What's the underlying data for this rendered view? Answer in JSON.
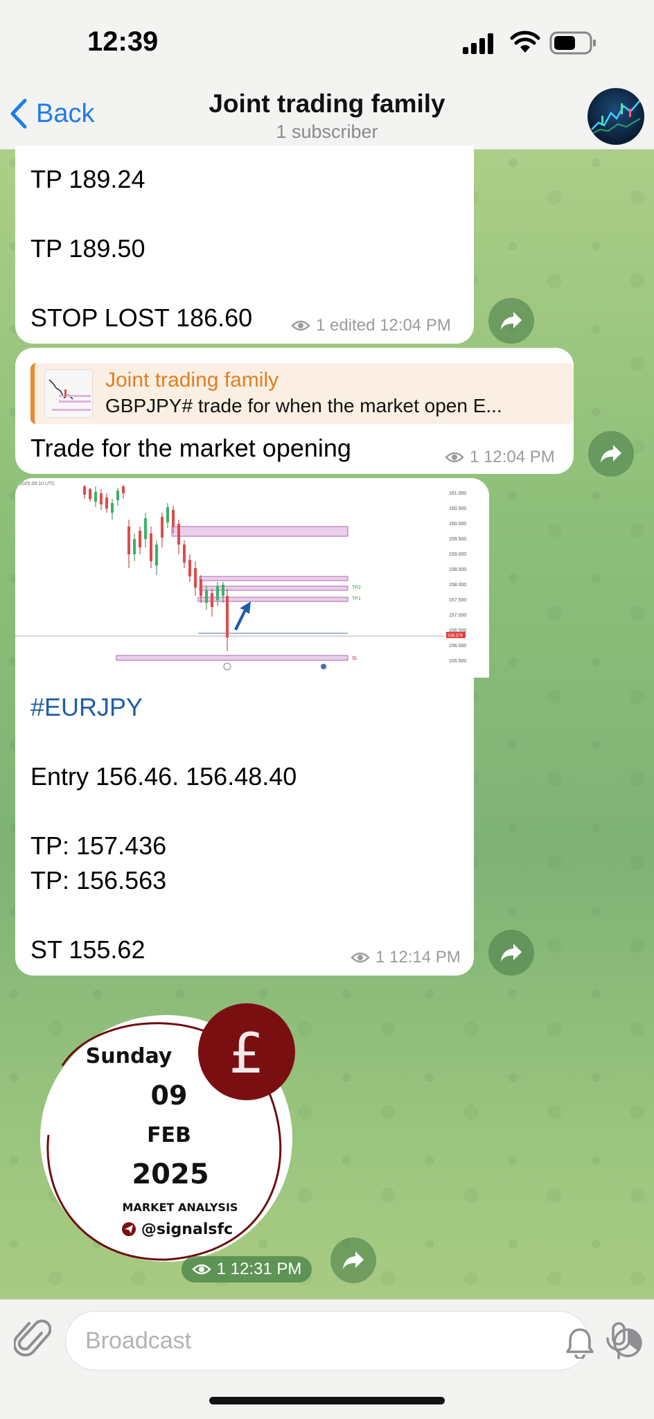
{
  "status_bar": {
    "time": "12:39"
  },
  "header": {
    "back_label": "Back",
    "title": "Joint trading family",
    "subtitle": "1 subscriber"
  },
  "messages": [
    {
      "lines": [
        "TP 189.24",
        "TP 189.50",
        "STOP LOST 186.60"
      ],
      "views": "1",
      "edited": "edited",
      "time": "12:04 PM"
    },
    {
      "reply_name": "Joint trading family",
      "reply_text": "GBPJPY# trade for when the market open E...",
      "text": "Trade for the market opening",
      "views": "1",
      "time": "12:04 PM"
    },
    {
      "hashtag": "#EURJPY",
      "lines": [
        "Entry 156.46.  156.48.40",
        "TP:   157.436",
        "TP:    156.563",
        "ST 155.62"
      ],
      "views": "1",
      "time": "12:14 PM",
      "chart_labels": {
        "tp1": "TP1",
        "tp2": "TP2",
        "sl": "SL",
        "header": "2025 09:10 UTC",
        "prices": [
          "161.000",
          "160.500",
          "160.000",
          "159.500",
          "159.000",
          "158.500",
          "158.000",
          "157.500",
          "157.000",
          "156.500",
          "156.000",
          "155.500"
        ],
        "current_price": "156.379"
      }
    },
    {
      "sticker": {
        "day": "Sunday",
        "date": "09",
        "month": "FEB",
        "year": "2025",
        "caption": "MARKET ANALYSIS",
        "handle": "@signalsfc",
        "currency_symbol": "£"
      },
      "views": "1",
      "time": "12:31 PM"
    }
  ],
  "input": {
    "placeholder": "Broadcast"
  },
  "colors": {
    "accent": "#1f7ce6",
    "reply_accent": "#e07e22",
    "hashtag": "#1f5da8",
    "sticker_maroon": "#7a0f12"
  }
}
